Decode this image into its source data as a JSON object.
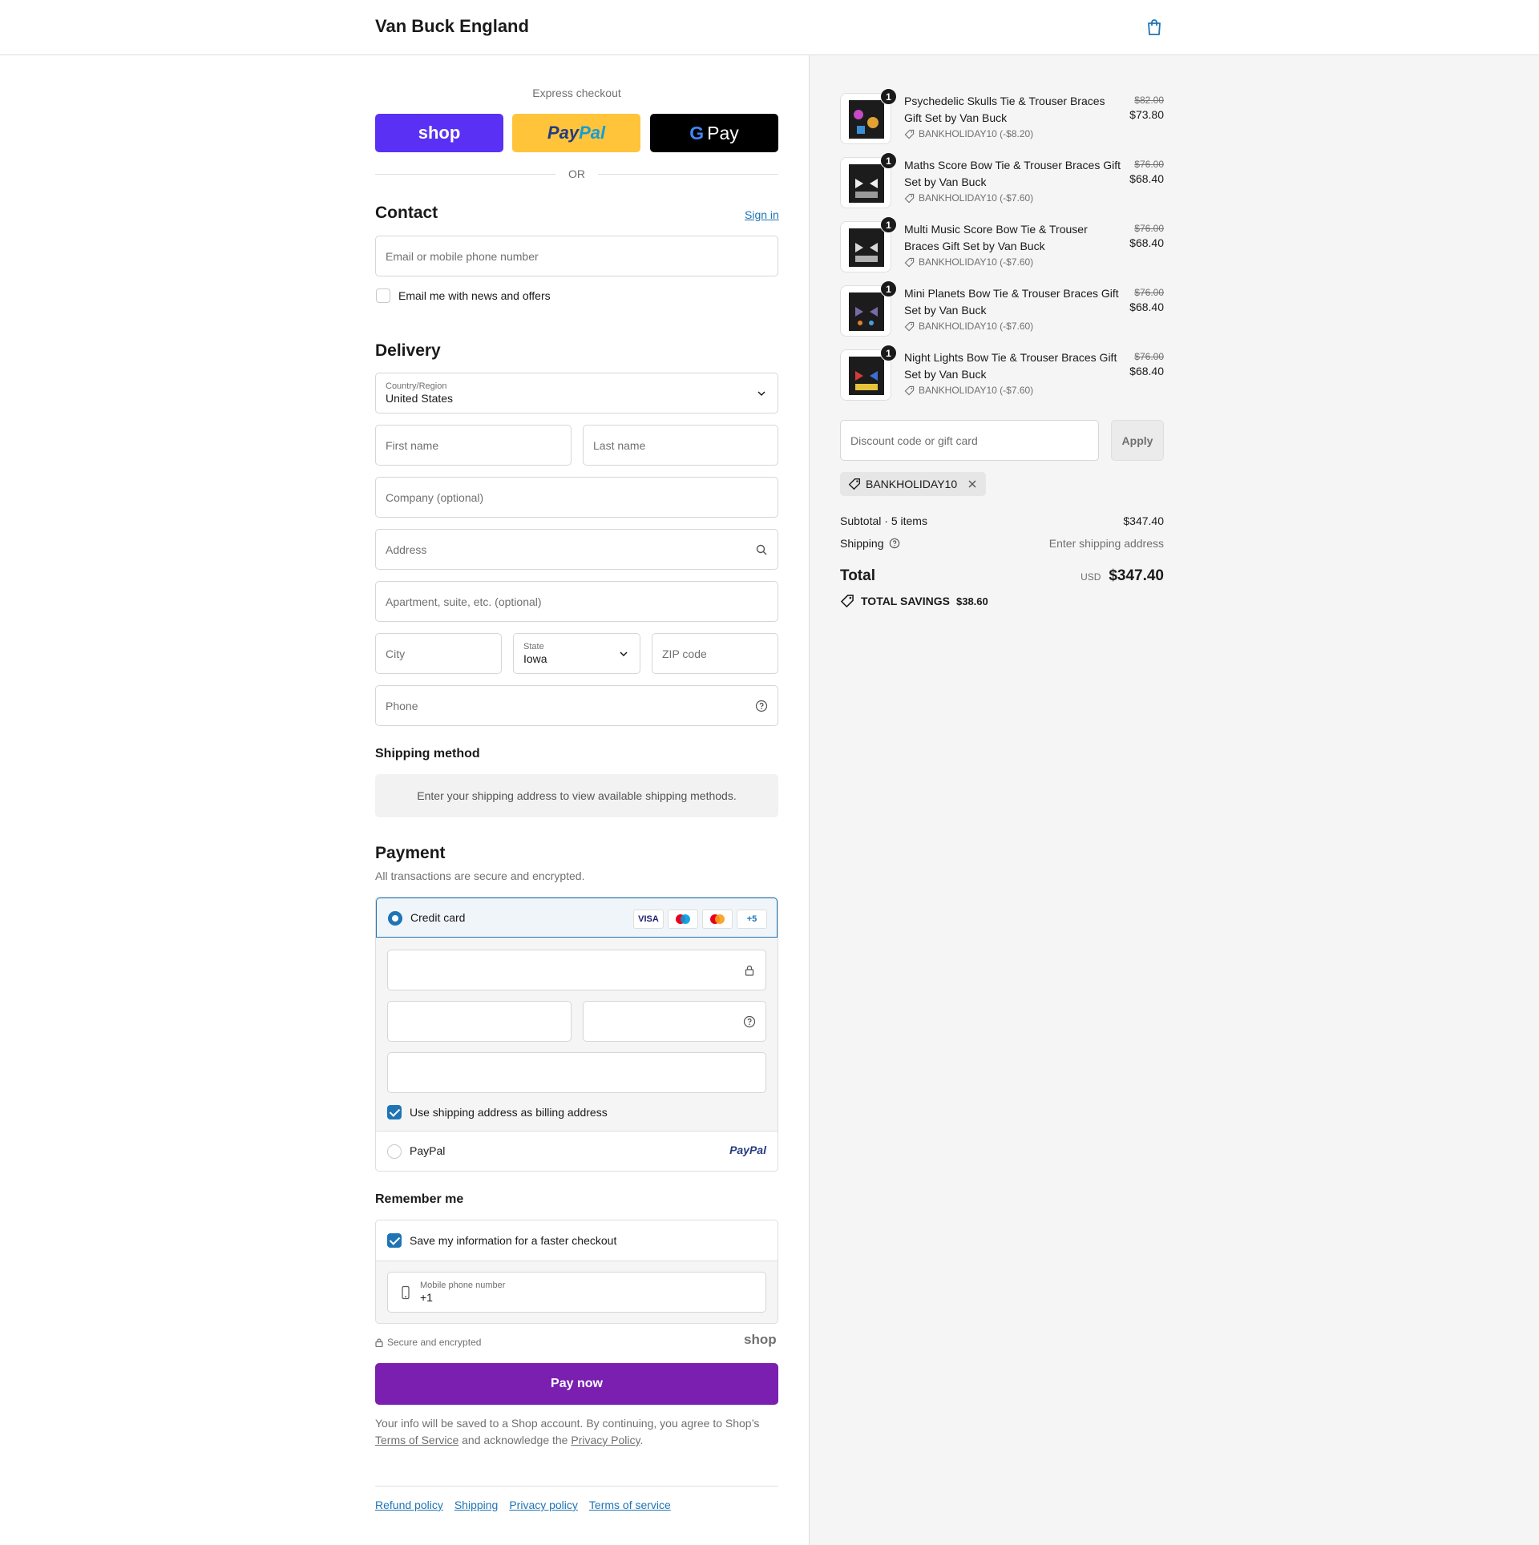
{
  "header": {
    "brand": "Van Buck England",
    "cart_icon": "shopping-bag-icon"
  },
  "express": {
    "label": "Express checkout",
    "shop_label": "shop",
    "paypal_label": "PayPal",
    "gpay_label": "Pay",
    "or_label": "OR"
  },
  "contact": {
    "title": "Contact",
    "sign_in": "Sign in",
    "email_placeholder": "Email or mobile phone number",
    "news_label": "Email me with news and offers"
  },
  "delivery": {
    "title": "Delivery",
    "country_label": "Country/Region",
    "country_value": "United States",
    "first_name": "First name",
    "last_name": "Last name",
    "company": "Company (optional)",
    "address": "Address",
    "apartment": "Apartment, suite, etc. (optional)",
    "city": "City",
    "state_label": "State",
    "state_value": "Iowa",
    "zip": "ZIP code",
    "phone": "Phone"
  },
  "shipping_method": {
    "title": "Shipping method",
    "info": "Enter your shipping address to view available shipping methods."
  },
  "payment": {
    "title": "Payment",
    "subtitle": "All transactions are secure and encrypted.",
    "credit_card_label": "Credit card",
    "card_badges": [
      "VISA",
      "+5"
    ],
    "billing_label": "Use shipping address as billing address",
    "paypal_label": "PayPal",
    "paypal_logo": "PayPal"
  },
  "remember": {
    "title": "Remember me",
    "save_label": "Save my information for a faster checkout",
    "mobile_label": "Mobile phone number",
    "mobile_value": "+1",
    "secure_label": "Secure and encrypted",
    "shop_logo": "shop"
  },
  "pay_now": "Pay now",
  "legal": {
    "text1": "Your info will be saved to a Shop account. By continuing, you agree to Shop’s",
    "tos": "Terms of Service",
    "text2": "and acknowledge the",
    "privacy": "Privacy Policy",
    "end": "."
  },
  "footer_links": [
    "Refund policy",
    "Shipping",
    "Privacy policy",
    "Terms of service"
  ],
  "order": {
    "items": [
      {
        "qty": "1",
        "name": "Psychedelic Skulls Tie & Trouser Braces Gift Set by Van Buck",
        "discount": "BANKHOLIDAY10 (-$8.20)",
        "original": "$82.00",
        "price": "$73.80"
      },
      {
        "qty": "1",
        "name": "Maths Score Bow Tie & Trouser Braces Gift Set by Van Buck",
        "discount": "BANKHOLIDAY10 (-$7.60)",
        "original": "$76.00",
        "price": "$68.40"
      },
      {
        "qty": "1",
        "name": "Multi Music Score Bow Tie & Trouser Braces Gift Set by Van Buck",
        "discount": "BANKHOLIDAY10 (-$7.60)",
        "original": "$76.00",
        "price": "$68.40"
      },
      {
        "qty": "1",
        "name": "Mini Planets Bow Tie & Trouser Braces Gift Set by Van Buck",
        "discount": "BANKHOLIDAY10 (-$7.60)",
        "original": "$76.00",
        "price": "$68.40"
      },
      {
        "qty": "1",
        "name": "Night Lights Bow Tie & Trouser Braces Gift Set by Van Buck",
        "discount": "BANKHOLIDAY10 (-$7.60)",
        "original": "$76.00",
        "price": "$68.40"
      }
    ],
    "discount_placeholder": "Discount code or gift card",
    "apply_label": "Apply",
    "applied_code": "BANKHOLIDAY10",
    "subtotal_label": "Subtotal · 5 items",
    "subtotal_value": "$347.40",
    "shipping_label": "Shipping",
    "shipping_value": "Enter shipping address",
    "total_label": "Total",
    "currency": "USD",
    "total_value": "$347.40",
    "savings_label": "TOTAL SAVINGS",
    "savings_value": "$38.60"
  },
  "colors": {
    "accent": "#1f74b5",
    "pay_button": "#7b1fb1",
    "shop_purple": "#5a31f4",
    "paypal_yellow": "#ffc439"
  }
}
